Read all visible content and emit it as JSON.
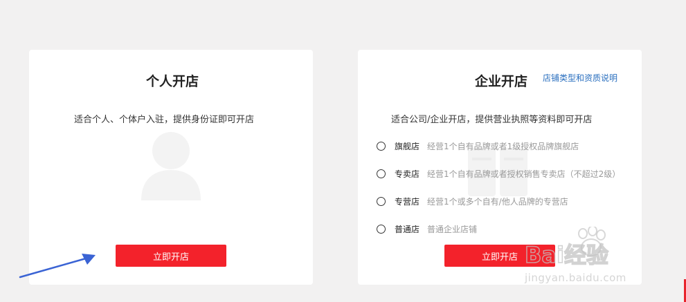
{
  "personal": {
    "title": "个人开店",
    "description": "适合个人、个体户入驻，提供身份证即可开店",
    "button_label": "立即开店"
  },
  "enterprise": {
    "title": "企业开店",
    "link_label": "店铺类型和资质说明",
    "description": "适合公司/企业开店，提供营业执照等资料即可开店",
    "options": [
      {
        "name": "旗舰店",
        "desc": "经营1个自有品牌或者1级授权品牌旗舰店"
      },
      {
        "name": "专卖店",
        "desc": "经营1个自有品牌或者授权销售专卖店（不超过2级）"
      },
      {
        "name": "专营店",
        "desc": "经营1个或多个自有/他人品牌的专营店"
      },
      {
        "name": "普通店",
        "desc": "普通企业店铺"
      }
    ],
    "button_label": "立即开店"
  },
  "watermark": {
    "logo_text": "Bai经验",
    "url_text": "jingyan.baidu.com"
  },
  "colors": {
    "accent": "#f3222b",
    "link": "#2a6fbf",
    "arrow": "#3a63d4"
  },
  "icons": {
    "avatar": "user-silhouette-icon",
    "arrow": "annotation-arrow-icon",
    "radio": "radio-unchecked-icon"
  }
}
